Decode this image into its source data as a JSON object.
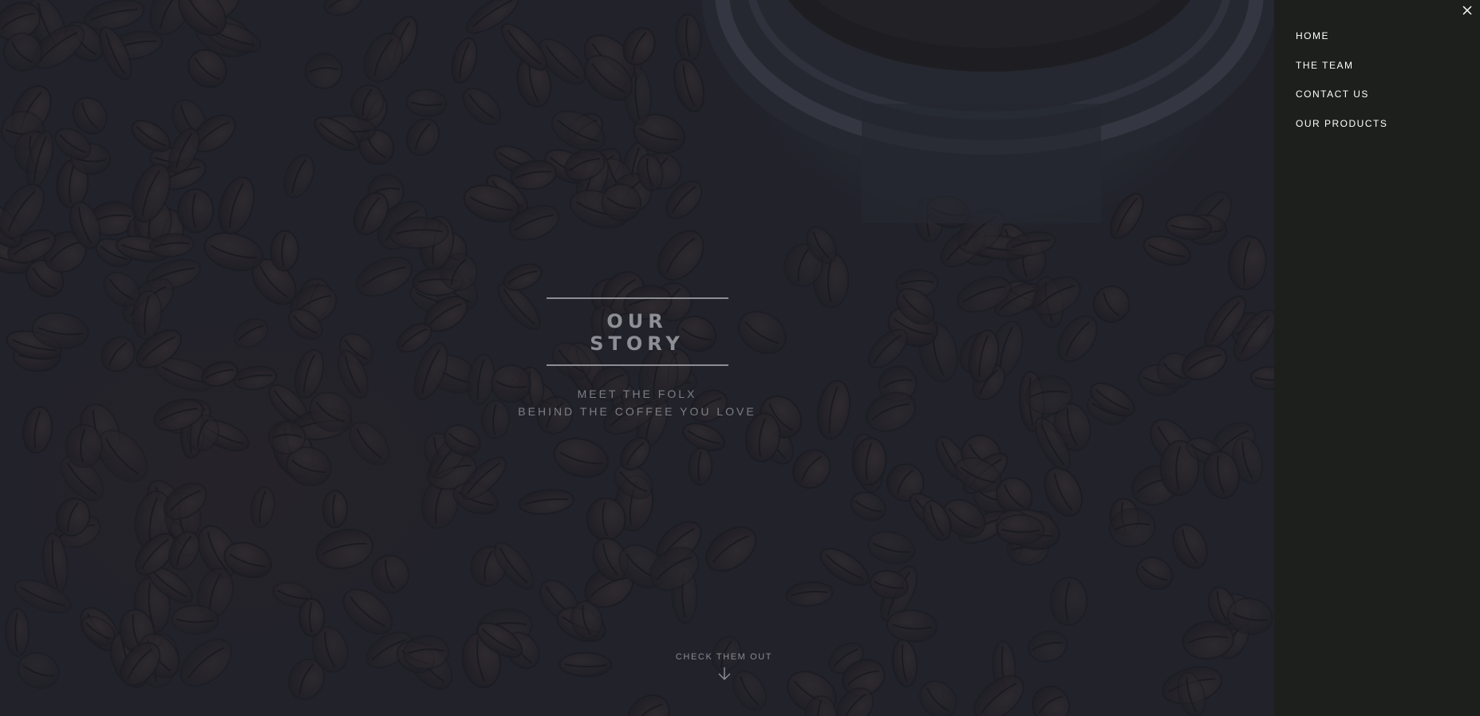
{
  "hero": {
    "title": "OUR STORY",
    "subtitle_line1": "MEET THE FOLX",
    "subtitle_line2": "BEHIND THE COFFEE YOU LOVE",
    "cta_label": "CHECK THEM OUT",
    "cta_icon": "arrow-down-icon",
    "background": "coffee-beans-photo"
  },
  "sidenav": {
    "close_icon": "close-icon",
    "items": [
      {
        "label": "HOME"
      },
      {
        "label": "THE TEAM"
      },
      {
        "label": "CONTACT US"
      },
      {
        "label": "OUR PRODUCTS"
      }
    ]
  },
  "colors": {
    "sidenav_bg": "#1d1f1c",
    "hero_text": "#8d8f95",
    "nav_text": "#ffffff"
  }
}
